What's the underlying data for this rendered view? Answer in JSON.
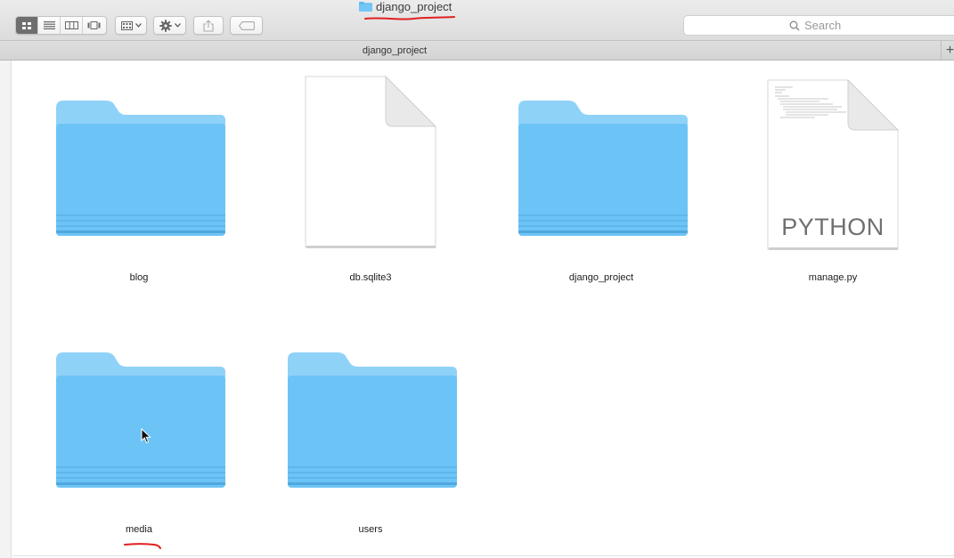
{
  "window": {
    "title": "django_project"
  },
  "toolbar": {
    "view_modes": [
      {
        "name": "icon-view",
        "icon": "grid-icon",
        "active": true
      },
      {
        "name": "list-view",
        "icon": "list-icon",
        "active": false
      },
      {
        "name": "column-view",
        "icon": "columns-icon",
        "active": false
      },
      {
        "name": "gallery-view",
        "icon": "gallery-icon",
        "active": false
      }
    ],
    "group_icon": "group-icon",
    "action_icon": "gear-icon",
    "share_icon": "share-icon",
    "tag_icon": "tag-icon"
  },
  "search": {
    "placeholder": "Search",
    "value": ""
  },
  "tabbar": {
    "title": "django_project",
    "new_tab_symbol": "+"
  },
  "files": [
    {
      "name": "blog",
      "kind": "folder"
    },
    {
      "name": "db.sqlite3",
      "kind": "document"
    },
    {
      "name": "django_project",
      "kind": "folder"
    },
    {
      "name": "manage.py",
      "kind": "python",
      "badge": "PYTHON"
    },
    {
      "name": "media",
      "kind": "folder"
    },
    {
      "name": "users",
      "kind": "folder"
    }
  ],
  "colors": {
    "folder_front": "#6cc4f6",
    "folder_back": "#8fd2f8",
    "annotation": "#e02020"
  }
}
